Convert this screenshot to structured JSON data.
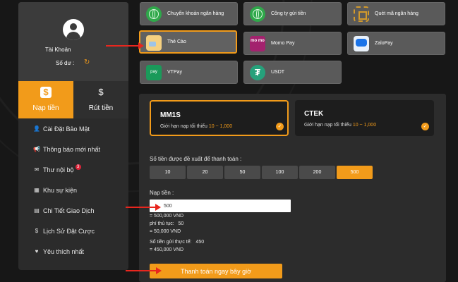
{
  "account": {
    "label": "Tài Khoản",
    "balance_label": "Số dư :",
    "refresh_icon": "refresh-icon",
    "avatar_icon": "user-avatar-icon"
  },
  "tabs": [
    {
      "label": "Nạp tiền",
      "icon": "deposit-icon",
      "active": true
    },
    {
      "label": "Rút tiền",
      "icon": "withdraw-icon",
      "active": false
    }
  ],
  "menu": [
    {
      "label": "Cài Đặt Bảo Mật",
      "icon": "user-settings-icon"
    },
    {
      "label": "Thông báo mới nhất",
      "icon": "megaphone-icon"
    },
    {
      "label": "Thư nội bộ",
      "icon": "mail-icon",
      "badge": "3"
    },
    {
      "label": "Khu sự kiện",
      "icon": "calendar-icon"
    },
    {
      "label": "Chi Tiết Giao Dịch",
      "icon": "clipboard-icon"
    },
    {
      "label": "Lịch Sử Đặt Cược",
      "icon": "dollar-coin-icon"
    },
    {
      "label": "Yêu thích nhất",
      "icon": "heart-icon"
    }
  ],
  "payment_methods": [
    {
      "label": "Chuyển khoản ngân hàng",
      "icon": "globe-icon"
    },
    {
      "label": "Công ty gửi tiền",
      "icon": "globe-icon"
    },
    {
      "label": "Quét mã ngân hàng",
      "icon": "qr-code-icon"
    },
    {
      "label": "Thẻ Cào",
      "icon": "scratch-card-icon",
      "selected": true
    },
    {
      "label": "Momo Pay",
      "icon": "momo-logo-icon",
      "logo_text": "mo mo"
    },
    {
      "label": "ZaloPay",
      "icon": "zalopay-logo-icon"
    },
    {
      "label": "VTPay",
      "icon": "vtpay-logo-icon",
      "logo_text": "pay"
    },
    {
      "label": "USDT",
      "icon": "tether-icon",
      "logo_text": "₮"
    }
  ],
  "providers": [
    {
      "name": "MM1S",
      "limit_prefix": "Giới hạn nạp tối thiểu",
      "limit_range": "10 ~ 1,000",
      "selected": true
    },
    {
      "name": "CTEK",
      "limit_prefix": "Giới hạn nạp tối thiểu",
      "limit_range": "10 ~ 1,000",
      "selected": false
    }
  ],
  "suggested": {
    "label": "Số tiền được đề xuất để thanh toán :",
    "amounts": [
      "10",
      "20",
      "50",
      "100",
      "200",
      "500"
    ],
    "active_index": 5
  },
  "deposit": {
    "label": "Nạp tiền :",
    "value": "500",
    "equivalent": "= 500,000 VND",
    "fee_label": "phí thủ tục:",
    "fee_value": "50",
    "fee_equivalent": "= 50,000 VND",
    "actual_label": "Số tiền gửi thực tế:",
    "actual_value": "450",
    "actual_equivalent": "= 450,000 VND"
  },
  "submit_label": "Thanh toán ngay bây giờ",
  "colors": {
    "accent": "#f29b1a",
    "annotation_arrow": "#e8261e"
  }
}
